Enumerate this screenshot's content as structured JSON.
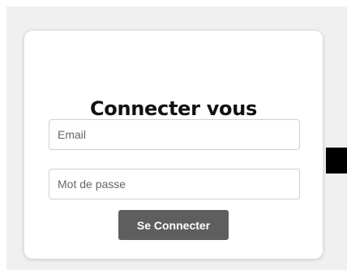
{
  "login": {
    "title": "Connecter vous",
    "email_placeholder": "Email",
    "email_value": "",
    "password_placeholder": "Mot de passe",
    "password_value": "",
    "submit_label": "Se Connecter"
  },
  "colors": {
    "backdrop": "#f0f0f0",
    "card": "#ffffff",
    "button": "#5e5e5e",
    "button_text": "#ffffff",
    "title": "#111111"
  }
}
